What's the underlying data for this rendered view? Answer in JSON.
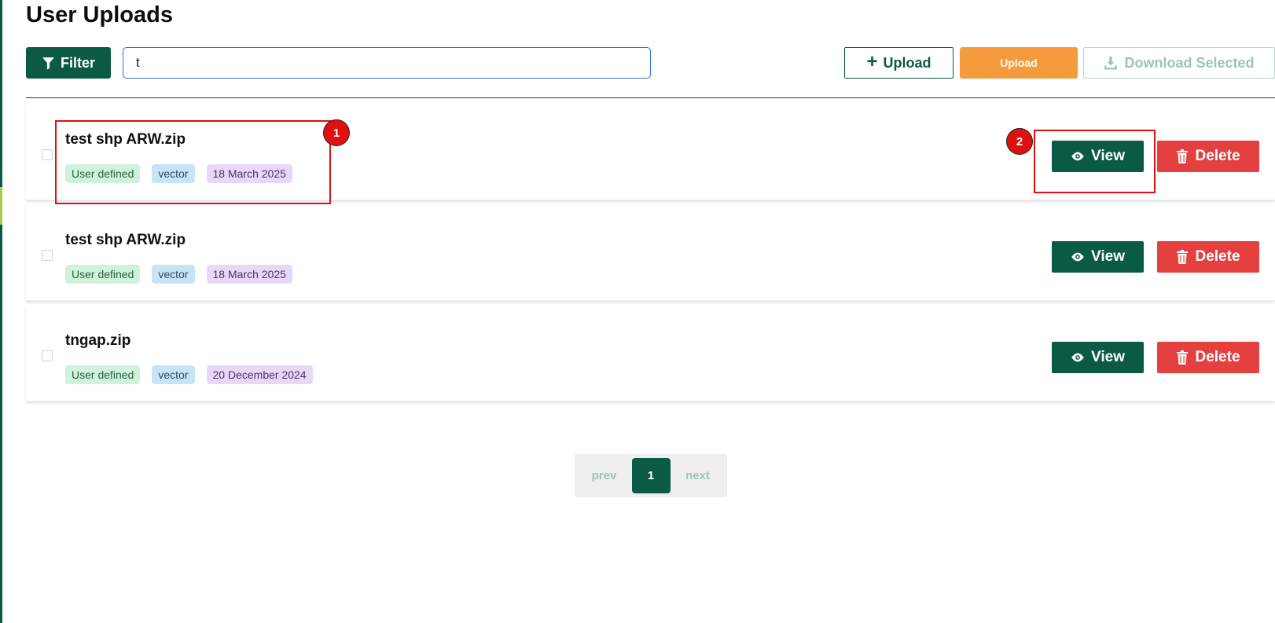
{
  "page": {
    "title": "User Uploads"
  },
  "toolbar": {
    "filter_label": "Filter",
    "search_value": "t",
    "upload_label": "Upload",
    "upload_secondary_label": "Upload",
    "download_label": "Download Selected"
  },
  "uploads": [
    {
      "name": "test shp ARW.zip",
      "source": "User defined",
      "type": "vector",
      "date": "18 March 2025",
      "view_label": "View",
      "delete_label": "Delete"
    },
    {
      "name": "test shp ARW.zip",
      "source": "User defined",
      "type": "vector",
      "date": "18 March 2025",
      "view_label": "View",
      "delete_label": "Delete"
    },
    {
      "name": "tngap.zip",
      "source": "User defined",
      "type": "vector",
      "date": "20 December 2024",
      "view_label": "View",
      "delete_label": "Delete"
    }
  ],
  "annotations": [
    {
      "label": "1",
      "target": "first-row-file-info"
    },
    {
      "label": "2",
      "target": "first-row-view-button"
    }
  ],
  "pagination": {
    "prev_label": "prev",
    "current_page": "1",
    "next_label": "next"
  },
  "colors": {
    "primary": "#0b5a45",
    "upload_orange": "#f59b3d",
    "delete_red": "#e44040",
    "annotation_red": "#e01010",
    "tag_green": "#cff2dc",
    "tag_blue": "#c7e4f7",
    "tag_purple": "#e8d8f8"
  },
  "icons": {
    "filter": "filter-funnel-icon",
    "upload": "plus-icon",
    "download": "download-icon",
    "view": "eye-icon",
    "delete": "trash-icon"
  }
}
